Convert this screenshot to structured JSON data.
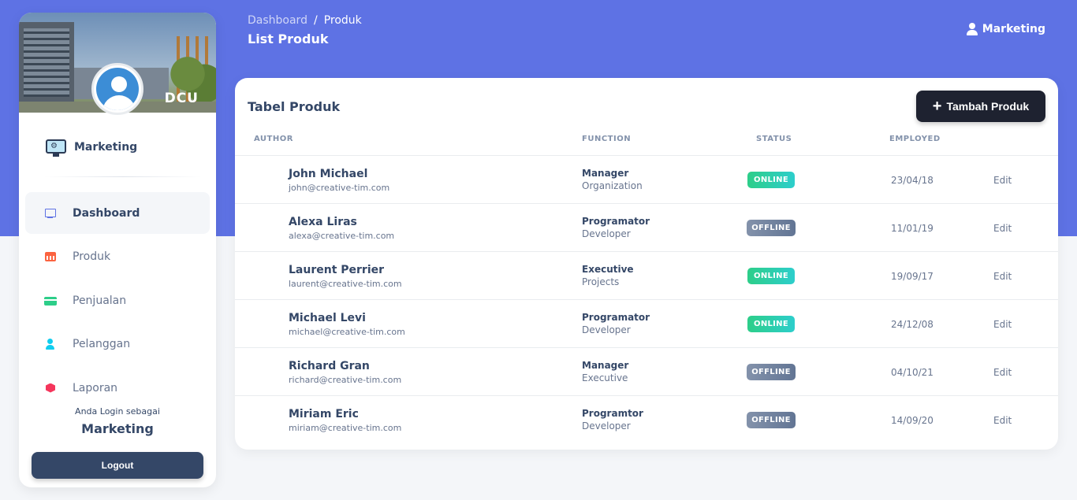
{
  "header": {
    "breadcrumb_root": "Dashboard",
    "breadcrumb_sep": "/",
    "breadcrumb_current": "Produk",
    "title": "List Produk",
    "user_label": "Marketing"
  },
  "sidebar": {
    "cover_text": "DCU",
    "brand_label": "Marketing",
    "items": [
      {
        "label": "Dashboard",
        "icon": "monitor-icon",
        "active": true
      },
      {
        "label": "Produk",
        "icon": "calendar-icon"
      },
      {
        "label": "Penjualan",
        "icon": "credit-card-icon"
      },
      {
        "label": "Pelanggan",
        "icon": "user-icon"
      },
      {
        "label": "Laporan",
        "icon": "box-icon"
      }
    ],
    "login_note": "Anda Login sebagai",
    "login_role": "Marketing",
    "logout_label": "Logout"
  },
  "table": {
    "title": "Tabel Produk",
    "add_button": "Tambah Produk",
    "columns": [
      "AUTHOR",
      "FUNCTION",
      "STATUS",
      "EMPLOYED"
    ],
    "rows": [
      {
        "name": "John Michael",
        "email": "john@creative-tim.com",
        "role": "Manager",
        "dept": "Organization",
        "status": "ONLINE",
        "employed": "23/04/18",
        "action": "Edit"
      },
      {
        "name": "Alexa Liras",
        "email": "alexa@creative-tim.com",
        "role": "Programator",
        "dept": "Developer",
        "status": "OFFLINE",
        "employed": "11/01/19",
        "action": "Edit"
      },
      {
        "name": "Laurent Perrier",
        "email": "laurent@creative-tim.com",
        "role": "Executive",
        "dept": "Projects",
        "status": "ONLINE",
        "employed": "19/09/17",
        "action": "Edit"
      },
      {
        "name": "Michael Levi",
        "email": "michael@creative-tim.com",
        "role": "Programator",
        "dept": "Developer",
        "status": "ONLINE",
        "employed": "24/12/08",
        "action": "Edit"
      },
      {
        "name": "Richard Gran",
        "email": "richard@creative-tim.com",
        "role": "Manager",
        "dept": "Executive",
        "status": "OFFLINE",
        "employed": "04/10/21",
        "action": "Edit"
      },
      {
        "name": "Miriam Eric",
        "email": "miriam@creative-tim.com",
        "role": "Programtor",
        "dept": "Developer",
        "status": "OFFLINE",
        "employed": "14/09/20",
        "action": "Edit"
      }
    ]
  },
  "colors": {
    "primary": "#5e72e4",
    "online": "#2dce89",
    "offline": "#8392ab",
    "dark": "#344767"
  }
}
